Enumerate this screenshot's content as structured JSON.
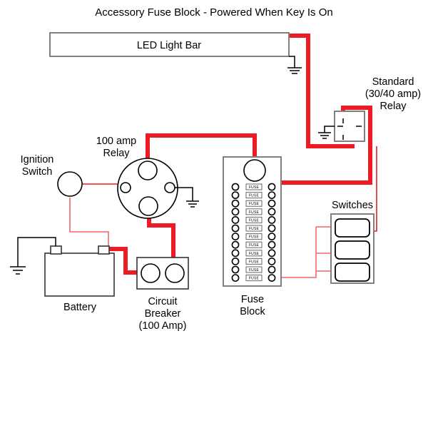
{
  "title": "Accessory Fuse Block - Powered When Key Is On",
  "colors": {
    "wire_main": "#ED1C24",
    "wire_secondary": "#F27B7B",
    "outline_gray": "#808080",
    "outline_dark": "#333333",
    "background": "#FFFFFF"
  },
  "components": {
    "led_light_bar": {
      "label": "LED Light Bar"
    },
    "standard_relay": {
      "label_line1": "Standard",
      "label_line2": "(30/40 amp)",
      "label_line3": "Relay"
    },
    "amp_relay": {
      "label_line1": "100 amp",
      "label_line2": "Relay"
    },
    "ignition_switch": {
      "label_line1": "Ignition",
      "label_line2": "Switch"
    },
    "battery": {
      "label": "Battery"
    },
    "circuit_breaker": {
      "label_line1": "Circuit",
      "label_line2": "Breaker",
      "label_line3": "(100 Amp)"
    },
    "fuse_block": {
      "label_line1": "Fuse",
      "label_line2": "Block",
      "fuse_label": "FUSE",
      "fuse_count": 12
    },
    "switches": {
      "label": "Switches",
      "switch_count": 3
    }
  }
}
